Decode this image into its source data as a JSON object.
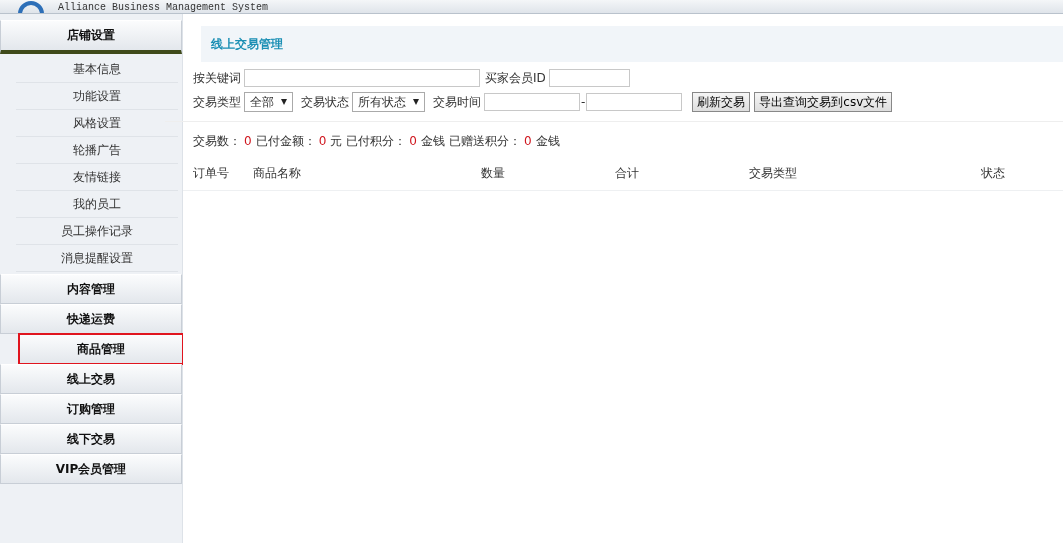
{
  "header": {
    "subtitle": "Alliance Business Management System"
  },
  "sidebar": {
    "sections": [
      {
        "label": "店铺设置",
        "expanded": true,
        "highlighted": false,
        "children": [
          {
            "label": "基本信息"
          },
          {
            "label": "功能设置"
          },
          {
            "label": "风格设置"
          },
          {
            "label": "轮播广告"
          },
          {
            "label": "友情链接"
          },
          {
            "label": "我的员工"
          },
          {
            "label": "员工操作记录"
          },
          {
            "label": "消息提醒设置"
          }
        ]
      },
      {
        "label": "内容管理",
        "expanded": false,
        "highlighted": false
      },
      {
        "label": "快递运费",
        "expanded": false,
        "highlighted": false
      },
      {
        "label": "商品管理",
        "expanded": false,
        "highlighted": true
      },
      {
        "label": "线上交易",
        "expanded": false,
        "highlighted": false
      },
      {
        "label": "订购管理",
        "expanded": false,
        "highlighted": false
      },
      {
        "label": "线下交易",
        "expanded": false,
        "highlighted": false
      },
      {
        "label": "VIP会员管理",
        "expanded": false,
        "highlighted": false
      }
    ]
  },
  "panel": {
    "title": "线上交易管理",
    "filters": {
      "keyword_label": "按关键词",
      "buyer_id_label": "买家会员ID",
      "type_label": "交易类型",
      "type_value": "全部",
      "status_label": "交易状态",
      "status_value": "所有状态",
      "time_label": "交易时间",
      "time_separator": "-",
      "buttons": [
        "刷新交易",
        "导出查询交易到csv文件"
      ]
    },
    "stats": [
      {
        "label": "交易数：",
        "value": "0"
      },
      {
        "label": "已付金额：",
        "value": "0",
        "unit": "元"
      },
      {
        "label": "已付积分：",
        "value": "0",
        "unit": "金钱"
      },
      {
        "label": "已赠送积分：",
        "value": "0",
        "unit": "金钱"
      }
    ],
    "table": {
      "columns": [
        "订单号",
        "商品名称",
        "数量",
        "合计",
        "交易类型",
        "状态"
      ]
    }
  }
}
